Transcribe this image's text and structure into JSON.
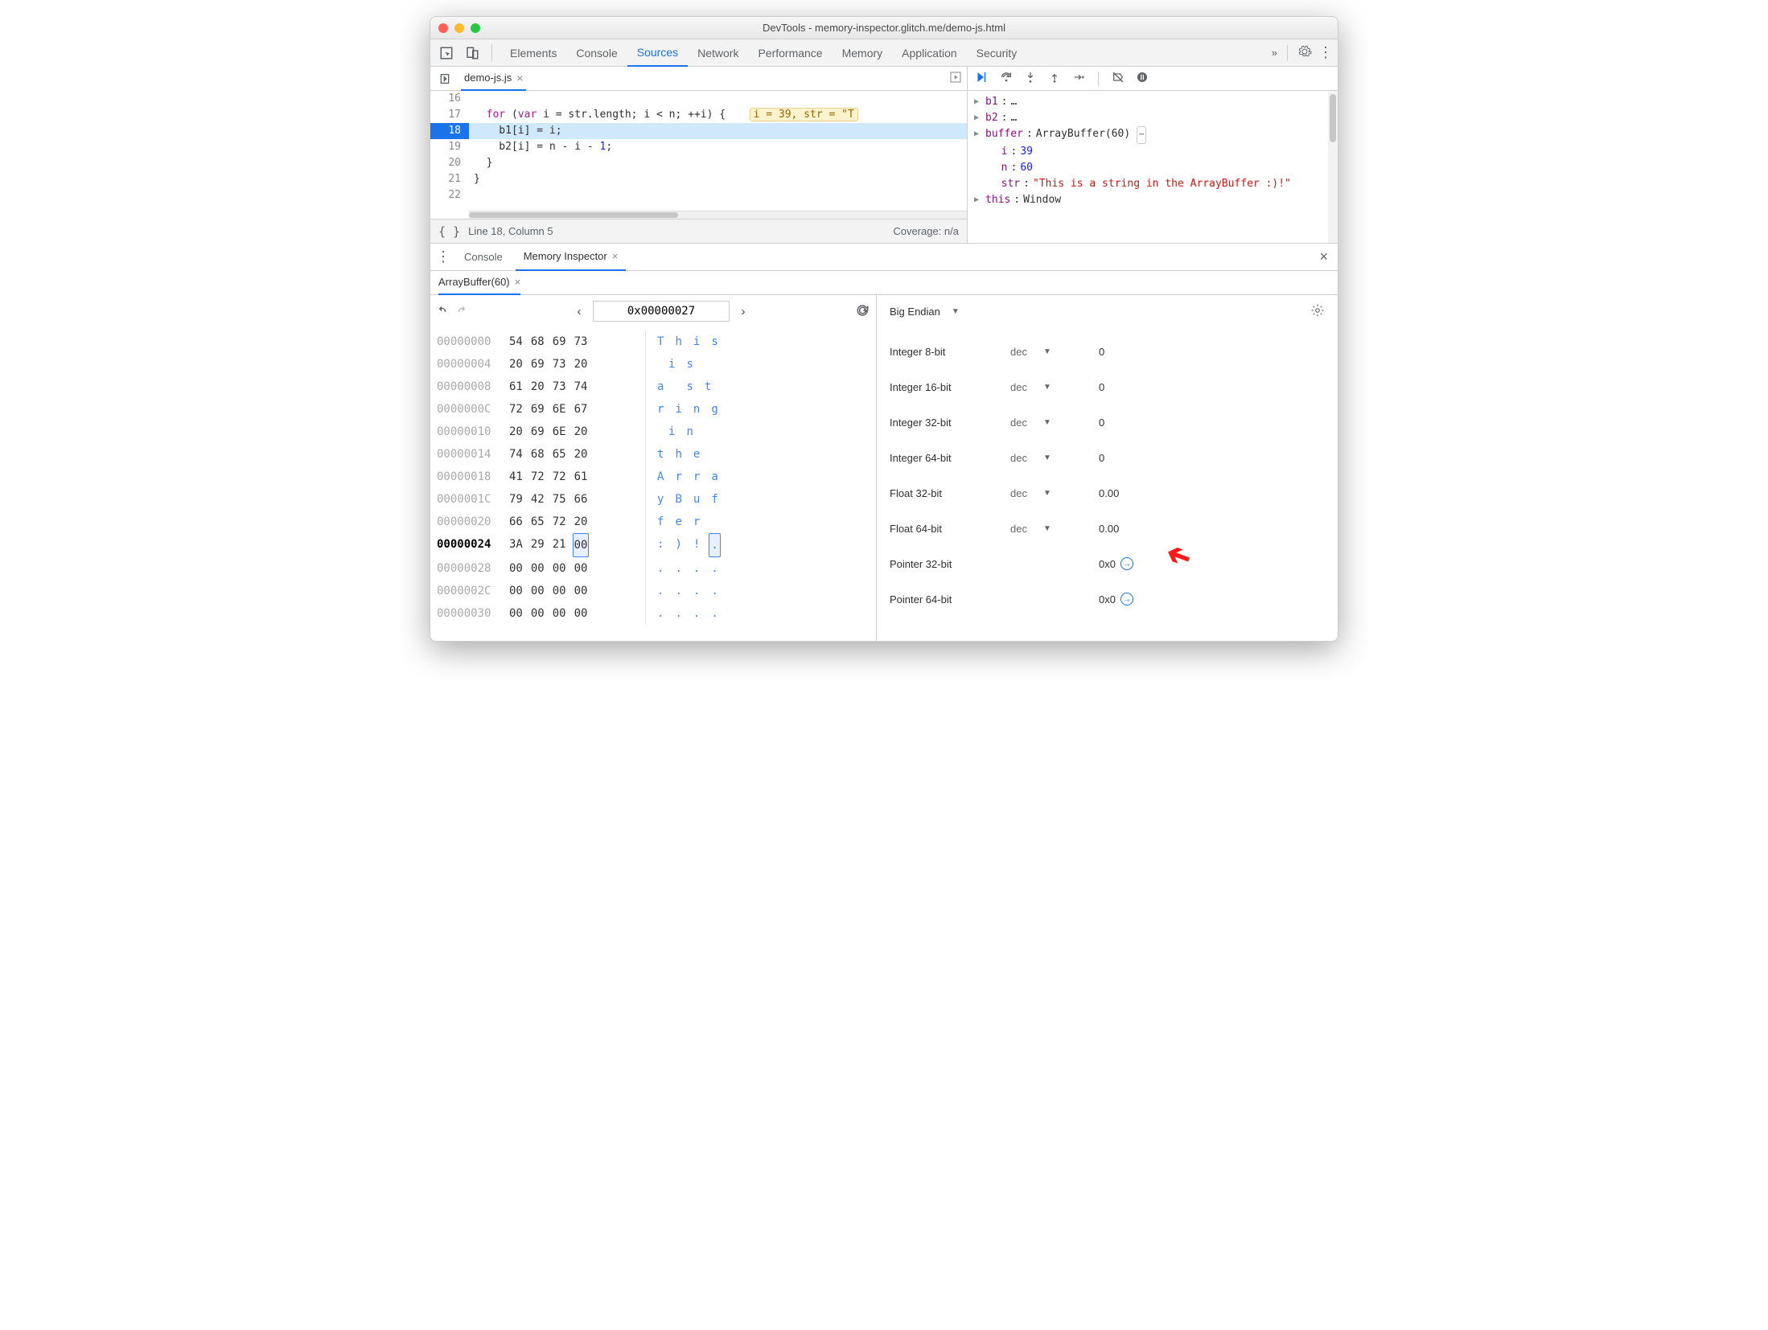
{
  "window": {
    "title": "DevTools - memory-inspector.glitch.me/demo-js.html"
  },
  "main_tabs": [
    "Elements",
    "Console",
    "Sources",
    "Network",
    "Performance",
    "Memory",
    "Application",
    "Security"
  ],
  "active_main_tab": "Sources",
  "more_tabs_icon": "»",
  "file_tab": {
    "name": "demo-js.js"
  },
  "code": {
    "lines": [
      {
        "num": "16",
        "text": ""
      },
      {
        "num": "17",
        "text": "  for (var i = str.length; i < n; ++i) {",
        "hint": "i = 39, str = \"T"
      },
      {
        "num": "18",
        "text": "    b1[i] = i;",
        "bp": true,
        "active": true
      },
      {
        "num": "19",
        "text": "    b2[i] = n - i - 1;"
      },
      {
        "num": "20",
        "text": "  }"
      },
      {
        "num": "21",
        "text": "}"
      },
      {
        "num": "22",
        "text": ""
      }
    ]
  },
  "status": {
    "pos": "Line 18, Column 5",
    "coverage": "Coverage: n/a"
  },
  "scope": {
    "b1": "…",
    "b2": "…",
    "buffer_label": "buffer",
    "buffer_val": "ArrayBuffer(60)",
    "i_label": "i",
    "i_val": "39",
    "n_label": "n",
    "n_val": "60",
    "str_label": "str",
    "str_val": "\"This is a string in the ArrayBuffer :)!\"",
    "this_label": "this",
    "this_val": "Window"
  },
  "drawer_tabs": {
    "console": "Console",
    "mem": "Memory Inspector"
  },
  "sub_tab": "ArrayBuffer(60)",
  "hex": {
    "address": "0x00000027",
    "rows": [
      {
        "addr": "00000000",
        "b": [
          "54",
          "68",
          "69",
          "73"
        ],
        "a": [
          "T",
          "h",
          "i",
          "s"
        ]
      },
      {
        "addr": "00000004",
        "b": [
          "20",
          "69",
          "73",
          "20"
        ],
        "a": [
          " ",
          "i",
          "s",
          " "
        ]
      },
      {
        "addr": "00000008",
        "b": [
          "61",
          "20",
          "73",
          "74"
        ],
        "a": [
          "a",
          " ",
          "s",
          "t"
        ]
      },
      {
        "addr": "0000000C",
        "b": [
          "72",
          "69",
          "6E",
          "67"
        ],
        "a": [
          "r",
          "i",
          "n",
          "g"
        ]
      },
      {
        "addr": "00000010",
        "b": [
          "20",
          "69",
          "6E",
          "20"
        ],
        "a": [
          " ",
          "i",
          "n",
          " "
        ]
      },
      {
        "addr": "00000014",
        "b": [
          "74",
          "68",
          "65",
          "20"
        ],
        "a": [
          "t",
          "h",
          "e",
          " "
        ]
      },
      {
        "addr": "00000018",
        "b": [
          "41",
          "72",
          "72",
          "61"
        ],
        "a": [
          "A",
          "r",
          "r",
          "a"
        ]
      },
      {
        "addr": "0000001C",
        "b": [
          "79",
          "42",
          "75",
          "66"
        ],
        "a": [
          "y",
          "B",
          "u",
          "f"
        ]
      },
      {
        "addr": "00000020",
        "b": [
          "66",
          "65",
          "72",
          "20"
        ],
        "a": [
          "f",
          "e",
          "r",
          " "
        ]
      },
      {
        "addr": "00000024",
        "b": [
          "3A",
          "29",
          "21",
          "00"
        ],
        "a": [
          ":",
          ")",
          "!",
          "."
        ],
        "bold": true,
        "sel": 3
      },
      {
        "addr": "00000028",
        "b": [
          "00",
          "00",
          "00",
          "00"
        ],
        "a": [
          ".",
          ".",
          ".",
          "."
        ]
      },
      {
        "addr": "0000002C",
        "b": [
          "00",
          "00",
          "00",
          "00"
        ],
        "a": [
          ".",
          ".",
          ".",
          "."
        ]
      },
      {
        "addr": "00000030",
        "b": [
          "00",
          "00",
          "00",
          "00"
        ],
        "a": [
          ".",
          ".",
          ".",
          "."
        ]
      }
    ]
  },
  "values": {
    "endian": "Big Endian",
    "rows": [
      {
        "label": "Integer 8-bit",
        "mode": "dec",
        "val": "0"
      },
      {
        "label": "Integer 16-bit",
        "mode": "dec",
        "val": "0"
      },
      {
        "label": "Integer 32-bit",
        "mode": "dec",
        "val": "0"
      },
      {
        "label": "Integer 64-bit",
        "mode": "dec",
        "val": "0"
      },
      {
        "label": "Float 32-bit",
        "mode": "dec",
        "val": "0.00"
      },
      {
        "label": "Float 64-bit",
        "mode": "dec",
        "val": "0.00"
      },
      {
        "label": "Pointer 32-bit",
        "mode": "",
        "val": "0x0",
        "link": true,
        "arrow": true
      },
      {
        "label": "Pointer 64-bit",
        "mode": "",
        "val": "0x0",
        "link": true
      }
    ]
  }
}
